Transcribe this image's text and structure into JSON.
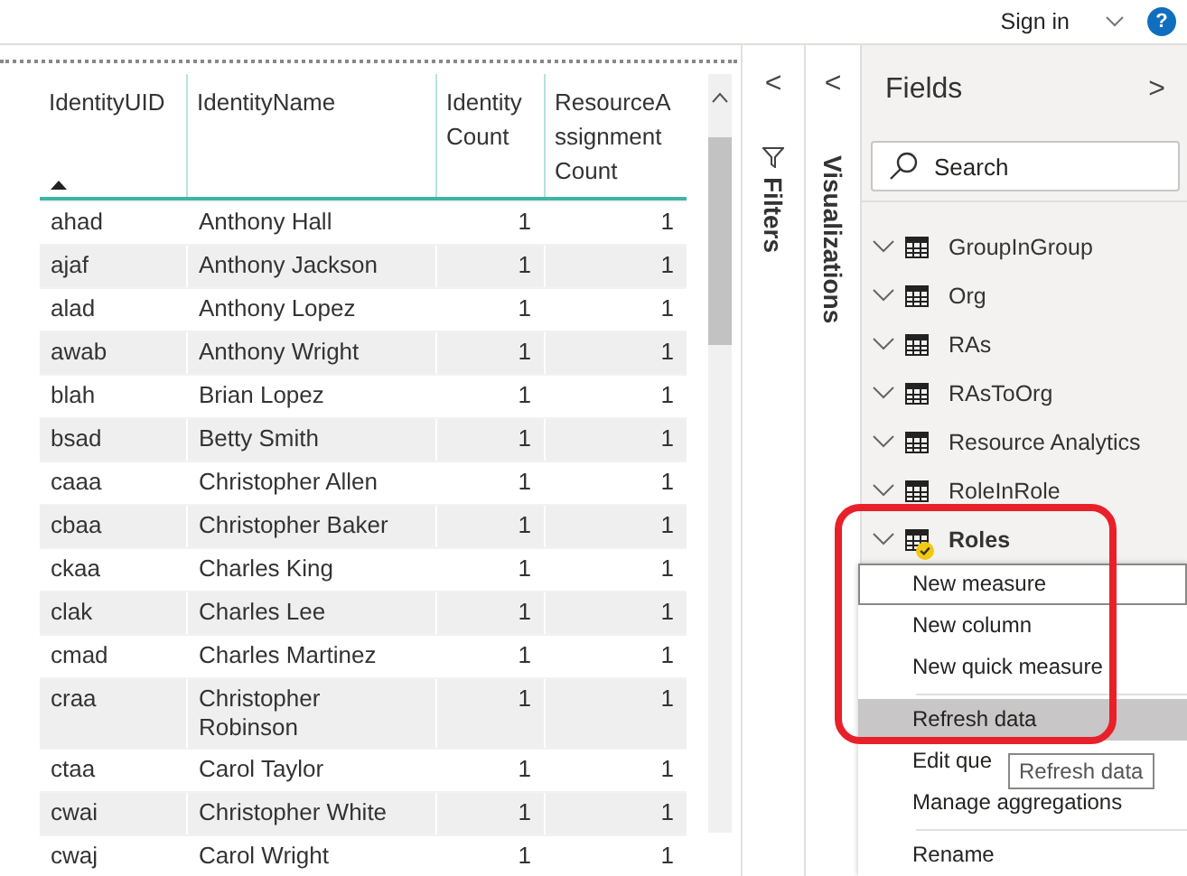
{
  "top_bar": {
    "sign_in": "Sign in",
    "help": "?"
  },
  "table": {
    "columns": [
      {
        "label": "IdentityUID",
        "sorted": true
      },
      {
        "label": "IdentityName",
        "sorted": false
      },
      {
        "label": "Identity Count",
        "sorted": false
      },
      {
        "label": "ResourceAssignment Count",
        "sorted": false
      }
    ],
    "rows": [
      [
        "ahad",
        "Anthony Hall",
        "1",
        "1"
      ],
      [
        "ajaf",
        "Anthony Jackson",
        "1",
        "1"
      ],
      [
        "alad",
        "Anthony Lopez",
        "1",
        "1"
      ],
      [
        "awab",
        "Anthony Wright",
        "1",
        "1"
      ],
      [
        "blah",
        "Brian Lopez",
        "1",
        "1"
      ],
      [
        "bsad",
        "Betty Smith",
        "1",
        "1"
      ],
      [
        "caaa",
        "Christopher Allen",
        "1",
        "1"
      ],
      [
        "cbaa",
        "Christopher Baker",
        "1",
        "1"
      ],
      [
        "ckaa",
        "Charles King",
        "1",
        "1"
      ],
      [
        "clak",
        "Charles Lee",
        "1",
        "1"
      ],
      [
        "cmad",
        "Charles Martinez",
        "1",
        "1"
      ],
      [
        "craa",
        "Christopher Robinson",
        "1",
        "1"
      ],
      [
        "ctaa",
        "Carol Taylor",
        "1",
        "1"
      ],
      [
        "cwai",
        "Christopher White",
        "1",
        "1"
      ],
      [
        "cwaj",
        "Carol Wright",
        "1",
        "1"
      ]
    ]
  },
  "filters_pane": {
    "title": "Filters",
    "collapse": "<"
  },
  "visualizations_pane": {
    "title": "Visualizations",
    "collapse": "<"
  },
  "fields_pane": {
    "title": "Fields",
    "expand": ">",
    "search": {
      "placeholder": "Search"
    },
    "items": [
      {
        "label": "GroupInGroup",
        "in_use": false
      },
      {
        "label": "Org",
        "in_use": false
      },
      {
        "label": "RAs",
        "in_use": false
      },
      {
        "label": "RAsToOrg",
        "in_use": false
      },
      {
        "label": "Resource Analytics",
        "in_use": false
      },
      {
        "label": "RoleInRole",
        "in_use": false
      },
      {
        "label": "Roles",
        "in_use": true
      }
    ]
  },
  "context_menu": {
    "items": [
      {
        "label": "New measure",
        "focused": true,
        "selected": false,
        "separator_after": false
      },
      {
        "label": "New column",
        "focused": false,
        "selected": false,
        "separator_after": false
      },
      {
        "label": "New quick measure",
        "focused": false,
        "selected": false,
        "separator_after": true
      },
      {
        "label": "Refresh data",
        "focused": false,
        "selected": true,
        "separator_after": false
      },
      {
        "label": "Edit que",
        "focused": false,
        "selected": false,
        "separator_after": false
      },
      {
        "label": "Manage aggregations",
        "focused": false,
        "selected": false,
        "separator_after": true
      },
      {
        "label": "Rename",
        "focused": false,
        "selected": false,
        "separator_after": false
      }
    ]
  },
  "tooltip": "Refresh data"
}
